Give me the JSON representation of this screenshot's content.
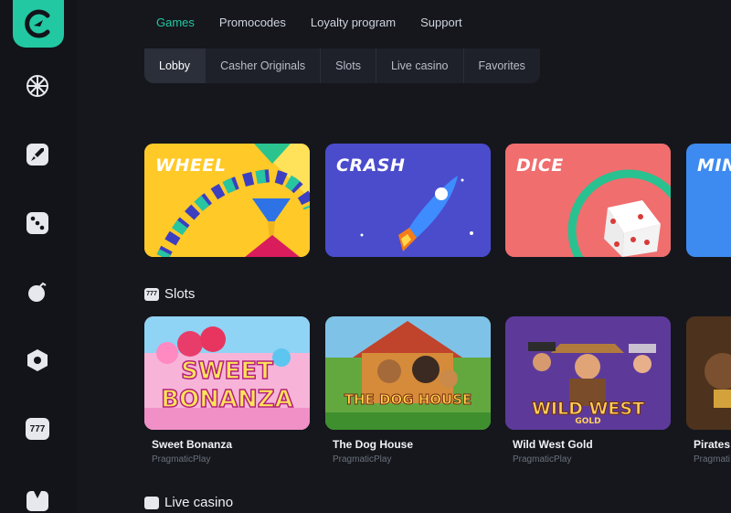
{
  "nav": {
    "items": [
      "Games",
      "Promocodes",
      "Loyalty program",
      "Support"
    ]
  },
  "tabs": [
    "Lobby",
    "Casher Originals",
    "Slots",
    "Live casino",
    "Favorites"
  ],
  "originals": [
    {
      "title": "WHEEL"
    },
    {
      "title": "CRASH"
    },
    {
      "title": "DICE"
    },
    {
      "title": "MIN"
    }
  ],
  "slots_section": {
    "title": "Slots",
    "icon": "777"
  },
  "slots": [
    {
      "name": "Sweet Bonanza",
      "provider": "PragmaticPlay",
      "art": [
        "SWEET",
        "BONANZA"
      ]
    },
    {
      "name": "The Dog House",
      "provider": "PragmaticPlay",
      "art": [
        "THE DOG HOUSE"
      ]
    },
    {
      "name": "Wild West Gold",
      "provider": "PragmaticPlay",
      "art": [
        "WILD WEST",
        "GOLD"
      ]
    },
    {
      "name": "Pirates",
      "provider": "Pragmati"
    }
  ],
  "live_section": {
    "title": "Live casino"
  },
  "sidebar": {
    "icons": [
      "wheel-icon",
      "rocket-icon",
      "dice-icon",
      "bomb-icon",
      "shield-icon",
      "slot-777-icon",
      "live-dealer-icon"
    ],
    "icon_text": {
      "slots": "777"
    }
  },
  "colors": {
    "accent": "#22c8a2",
    "background": "#15171d",
    "sidebar": "#121419"
  }
}
